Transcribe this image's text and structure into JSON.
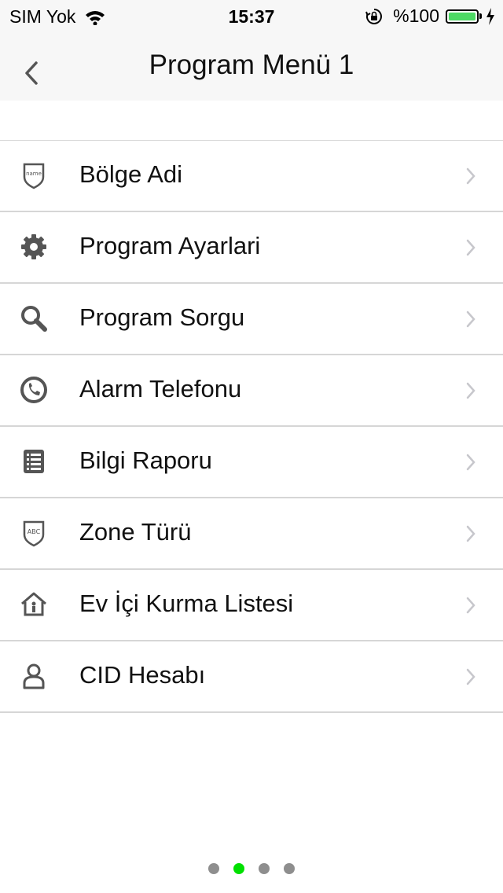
{
  "status_bar": {
    "carrier": "SIM Yok",
    "time": "15:37",
    "battery": "%100",
    "battery_color": "#4cd964"
  },
  "nav": {
    "title": "Program Menü 1",
    "back_icon": "chevron-left-icon"
  },
  "menu": {
    "items": [
      {
        "label": "Bölge Adi",
        "icon": "name-shield-icon"
      },
      {
        "label": "Program Ayarlari",
        "icon": "gear-icon"
      },
      {
        "label": "Program Sorgu",
        "icon": "search-icon"
      },
      {
        "label": "Alarm Telefonu",
        "icon": "phone-icon"
      },
      {
        "label": "Bilgi Raporu",
        "icon": "list-icon"
      },
      {
        "label": "Zone Türü",
        "icon": "abc-shield-icon"
      },
      {
        "label": "Ev İçi Kurma Listesi",
        "icon": "home-icon"
      },
      {
        "label": "CID Hesabı",
        "icon": "person-icon"
      }
    ]
  },
  "pagination": {
    "total": 4,
    "active_index": 1,
    "active_color": "#00e000",
    "inactive_color": "#8e8e8e"
  }
}
